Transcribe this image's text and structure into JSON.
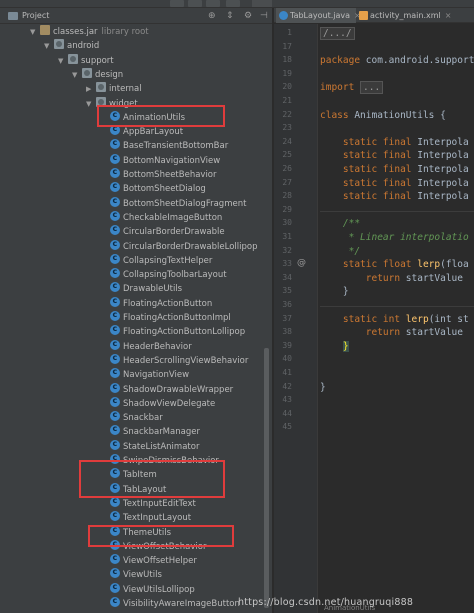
{
  "panel": {
    "title": "Project"
  },
  "tree": [
    {
      "label": "classes.jar",
      "suffix": "library root",
      "depth": 0,
      "arrow": "▼",
      "icon": "jar-icon"
    },
    {
      "label": "android",
      "depth": 1,
      "arrow": "▼",
      "icon": "package-icon"
    },
    {
      "label": "support",
      "depth": 2,
      "arrow": "▼",
      "icon": "package-icon"
    },
    {
      "label": "design",
      "depth": 3,
      "arrow": "▼",
      "icon": "package-icon"
    },
    {
      "label": "internal",
      "depth": 4,
      "arrow": "▶",
      "icon": "package-icon"
    },
    {
      "label": "widget",
      "depth": 4,
      "arrow": "▼",
      "icon": "package-icon"
    },
    {
      "label": "AnimationUtils",
      "depth": 5,
      "icon": "class-icon"
    },
    {
      "label": "AppBarLayout",
      "depth": 5,
      "icon": "class-icon"
    },
    {
      "label": "BaseTransientBottomBar",
      "depth": 5,
      "icon": "class-icon"
    },
    {
      "label": "BottomNavigationView",
      "depth": 5,
      "icon": "class-icon"
    },
    {
      "label": "BottomSheetBehavior",
      "depth": 5,
      "icon": "class-icon"
    },
    {
      "label": "BottomSheetDialog",
      "depth": 5,
      "icon": "class-icon"
    },
    {
      "label": "BottomSheetDialogFragment",
      "depth": 5,
      "icon": "class-icon"
    },
    {
      "label": "CheckableImageButton",
      "depth": 5,
      "icon": "class-icon"
    },
    {
      "label": "CircularBorderDrawable",
      "depth": 5,
      "icon": "class-icon"
    },
    {
      "label": "CircularBorderDrawableLollipop",
      "depth": 5,
      "icon": "class-icon"
    },
    {
      "label": "CollapsingTextHelper",
      "depth": 5,
      "icon": "class-icon"
    },
    {
      "label": "CollapsingToolbarLayout",
      "depth": 5,
      "icon": "class-icon"
    },
    {
      "label": "DrawableUtils",
      "depth": 5,
      "icon": "class-icon"
    },
    {
      "label": "FloatingActionButton",
      "depth": 5,
      "icon": "class-icon"
    },
    {
      "label": "FloatingActionButtonImpl",
      "depth": 5,
      "icon": "class-icon"
    },
    {
      "label": "FloatingActionButtonLollipop",
      "depth": 5,
      "icon": "class-icon"
    },
    {
      "label": "HeaderBehavior",
      "depth": 5,
      "icon": "class-icon"
    },
    {
      "label": "HeaderScrollingViewBehavior",
      "depth": 5,
      "icon": "class-icon"
    },
    {
      "label": "NavigationView",
      "depth": 5,
      "icon": "class-icon"
    },
    {
      "label": "ShadowDrawableWrapper",
      "depth": 5,
      "icon": "class-icon"
    },
    {
      "label": "ShadowViewDelegate",
      "depth": 5,
      "icon": "class-icon"
    },
    {
      "label": "Snackbar",
      "depth": 5,
      "icon": "class-icon"
    },
    {
      "label": "SnackbarManager",
      "depth": 5,
      "icon": "class-icon"
    },
    {
      "label": "StateListAnimator",
      "depth": 5,
      "icon": "class-icon"
    },
    {
      "label": "SwipeDismissBehavior",
      "depth": 5,
      "icon": "class-icon"
    },
    {
      "label": "TabItem",
      "depth": 5,
      "icon": "class-icon"
    },
    {
      "label": "TabLayout",
      "depth": 5,
      "icon": "class-icon"
    },
    {
      "label": "TextInputEditText",
      "depth": 5,
      "icon": "class-icon"
    },
    {
      "label": "TextInputLayout",
      "depth": 5,
      "icon": "class-icon"
    },
    {
      "label": "ThemeUtils",
      "depth": 5,
      "icon": "class-icon"
    },
    {
      "label": "ViewOffsetBehavior",
      "depth": 5,
      "icon": "class-icon"
    },
    {
      "label": "ViewOffsetHelper",
      "depth": 5,
      "icon": "class-icon"
    },
    {
      "label": "ViewUtils",
      "depth": 5,
      "icon": "class-icon"
    },
    {
      "label": "ViewUtilsLollipop",
      "depth": 5,
      "icon": "class-icon"
    },
    {
      "label": "VisibilityAwareImageButton",
      "depth": 5,
      "icon": "class-icon"
    }
  ],
  "editor": {
    "tabs": [
      {
        "label": "TabLayout.java",
        "icon": "class-icon",
        "close": "×"
      },
      {
        "label": "activity_main.xml",
        "icon": "xml-icon",
        "close": "×"
      }
    ],
    "line_numbers": [
      "1",
      "17",
      "18",
      "19",
      "20",
      "21",
      "22",
      "23",
      "24",
      "25",
      "26",
      "27",
      "28",
      "29",
      "30",
      "31",
      "32",
      "33",
      "34",
      "35",
      "36",
      "37",
      "38",
      "39",
      "40",
      "41",
      "42",
      "43",
      "44",
      "45"
    ],
    "gutter_marker": "@",
    "lines": [
      [
        {
          "t": "/.../",
          "c": "fold"
        }
      ],
      [],
      [
        {
          "t": "package ",
          "c": "kw"
        },
        {
          "t": "com.android.support",
          "c": "pkgname"
        }
      ],
      [],
      [
        {
          "t": "import ",
          "c": "kw"
        },
        {
          "t": "...",
          "c": "fold"
        }
      ],
      [],
      [
        {
          "t": "class ",
          "c": "kw"
        },
        {
          "t": "AnimationUtils {",
          "c": ""
        }
      ],
      [],
      [
        {
          "t": "    static final ",
          "c": "kw"
        },
        {
          "t": "Interpola",
          "c": ""
        }
      ],
      [
        {
          "t": "    static final ",
          "c": "kw"
        },
        {
          "t": "Interpola",
          "c": ""
        }
      ],
      [
        {
          "t": "    static final ",
          "c": "kw"
        },
        {
          "t": "Interpola",
          "c": ""
        }
      ],
      [
        {
          "t": "    static final ",
          "c": "kw"
        },
        {
          "t": "Interpola",
          "c": ""
        }
      ],
      [
        {
          "t": "    static final ",
          "c": "kw"
        },
        {
          "t": "Interpola",
          "c": ""
        }
      ],
      [],
      [
        {
          "t": "    /**",
          "c": "cmt"
        }
      ],
      [
        {
          "t": "     * Linear interpolatio",
          "c": "cmt"
        }
      ],
      [
        {
          "t": "     */",
          "c": "cmt"
        }
      ],
      [
        {
          "t": "    static float ",
          "c": "kw"
        },
        {
          "t": "lerp",
          "c": "type"
        },
        {
          "t": "(floa",
          "c": ""
        }
      ],
      [
        {
          "t": "        return ",
          "c": "kw"
        },
        {
          "t": "startValue",
          "c": ""
        }
      ],
      [
        {
          "t": "    }",
          "c": ""
        }
      ],
      [],
      [
        {
          "t": "    static int ",
          "c": "kw"
        },
        {
          "t": "lerp",
          "c": "type"
        },
        {
          "t": "(int st",
          "c": ""
        }
      ],
      [
        {
          "t": "        return ",
          "c": "kw"
        },
        {
          "t": "startValue",
          "c": ""
        }
      ],
      [
        {
          "t": "    ",
          "c": ""
        },
        {
          "t": "}",
          "c": "brace-hl"
        }
      ],
      [],
      [],
      [
        {
          "t": "}",
          "c": ""
        }
      ],
      [],
      [],
      []
    ],
    "status": "AnimationUtils"
  },
  "watermark": "https://blog.csdn.net/huangruqi888",
  "colors": {
    "highlight_box": "#e03c3c",
    "class_icon": "#3b86c7"
  }
}
